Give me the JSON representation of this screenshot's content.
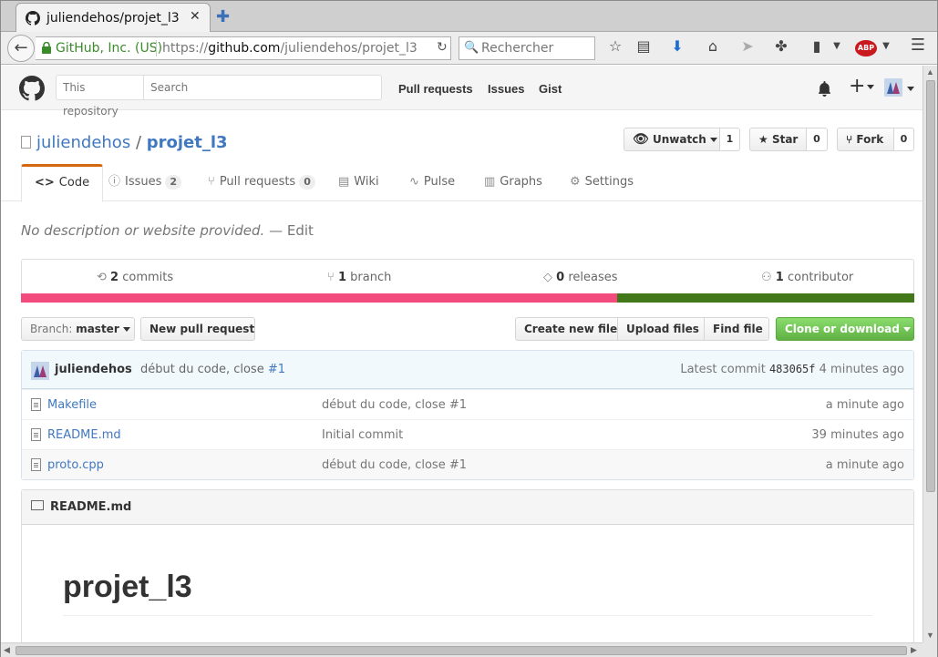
{
  "browser": {
    "tab_title": "juliendehos/projet_l3",
    "identity": "GitHub, Inc. (US)",
    "url_prefix": "https://",
    "url_host": "github.com",
    "url_path": "/juliendehos/projet_l3",
    "search_placeholder": "Rechercher"
  },
  "header": {
    "search_scope": "This repository",
    "search_placeholder": "Search",
    "nav": [
      "Pull requests",
      "Issues",
      "Gist"
    ]
  },
  "repo": {
    "owner": "juliendehos",
    "separator": "/",
    "name": "projet_l3",
    "unwatch_label": "Unwatch",
    "watch_count": "1",
    "star_label": "Star",
    "star_count": "0",
    "fork_label": "Fork",
    "fork_count": "0"
  },
  "tabs": [
    {
      "label": "Code",
      "count": null,
      "icon": "code-icon"
    },
    {
      "label": "Issues",
      "count": "2",
      "icon": "issue-icon"
    },
    {
      "label": "Pull requests",
      "count": "0",
      "icon": "pull-request-icon"
    },
    {
      "label": "Wiki",
      "count": null,
      "icon": "book-icon"
    },
    {
      "label": "Pulse",
      "count": null,
      "icon": "pulse-icon"
    },
    {
      "label": "Graphs",
      "count": null,
      "icon": "graph-icon"
    },
    {
      "label": "Settings",
      "count": null,
      "icon": "gear-icon"
    }
  ],
  "description": {
    "text": "No description or website provided.",
    "edit_sep": "—",
    "edit_label": "Edit"
  },
  "summary": {
    "commits_count": "2",
    "commits_label": "commits",
    "branch_count": "1",
    "branch_label": "branch",
    "releases_count": "0",
    "releases_label": "releases",
    "contributor_count": "1",
    "contributor_label": "contributor",
    "languages": [
      {
        "color": "#f34b7d",
        "percent": 66.7
      },
      {
        "color": "#427819",
        "percent": 33.3
      }
    ]
  },
  "toolbar": {
    "branch_prefix": "Branch:",
    "branch_name": "master",
    "new_pr": "New pull request",
    "create_file": "Create new file",
    "upload_files": "Upload files",
    "find_file": "Find file",
    "clone": "Clone or download"
  },
  "commit": {
    "author": "juliendehos",
    "message": "début du code, close",
    "issue_ref": "#1",
    "latest_label": "Latest commit",
    "sha": "483065f",
    "age": "4 minutes ago"
  },
  "files": [
    {
      "name": "Makefile",
      "message": "début du code, close #1",
      "age": "a minute ago"
    },
    {
      "name": "README.md",
      "message": "Initial commit",
      "age": "39 minutes ago"
    },
    {
      "name": "proto.cpp",
      "message": "début du code, close #1",
      "age": "a minute ago"
    }
  ],
  "readme": {
    "filename": "README.md",
    "heading": "projet_l3"
  },
  "colors": {
    "link": "#4078c0",
    "tab_accent": "#d26911",
    "clone_green": "#60b044"
  }
}
